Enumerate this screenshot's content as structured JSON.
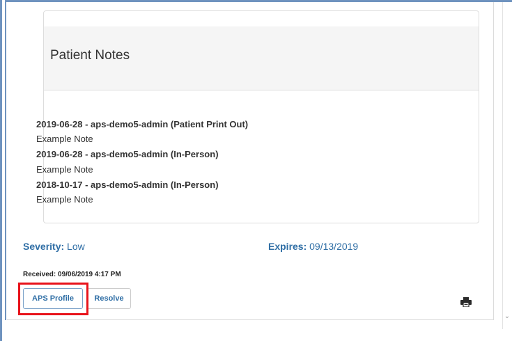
{
  "notes": {
    "title": "Patient Notes",
    "entries": [
      {
        "heading": "2019-06-28 - aps-demo5-admin (Patient Print Out)",
        "body": "Example Note"
      },
      {
        "heading": "2019-06-28 - aps-demo5-admin (In-Person)",
        "body": "Example Note"
      },
      {
        "heading": "2018-10-17 - aps-demo5-admin (In-Person)",
        "body": "Example Note"
      }
    ]
  },
  "meta": {
    "severity_label": "Severity:",
    "severity_value": "Low",
    "expires_label": "Expires:",
    "expires_value": "09/13/2019",
    "received": "Received: 09/06/2019 4:17 PM"
  },
  "actions": {
    "aps_profile_label": "APS Profile",
    "resolve_label": "Resolve",
    "print_icon": "printer-icon"
  },
  "colors": {
    "link": "#2f6ea5",
    "highlight": "#e8131b",
    "header_bg": "#f5f5f5"
  },
  "scrollbar": {
    "arrow_icon": "chevron-down-icon"
  }
}
